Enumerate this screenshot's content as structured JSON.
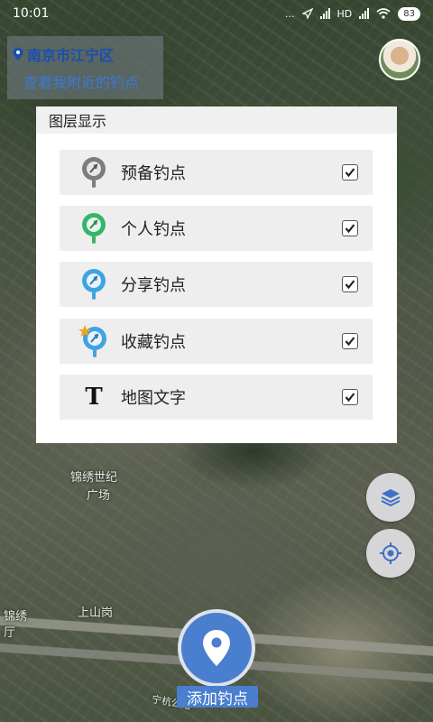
{
  "status_bar": {
    "time": "10:01",
    "dots": "...",
    "network": "HD",
    "battery": "83"
  },
  "location": {
    "city": "南京市江宁区",
    "subtitle": "查看我附近的钓点"
  },
  "map_labels": {
    "plaza": "锦绣世纪",
    "plaza2": "广场",
    "village": "上山岗",
    "left_label": "锦绣",
    "left_label2": "厅",
    "road": "宁杭公路"
  },
  "layer_dialog": {
    "title": "图层显示",
    "items": [
      {
        "label": "预备钓点",
        "icon": "gray-fishing-pin-icon",
        "checked": true
      },
      {
        "label": "个人钓点",
        "icon": "green-fishing-pin-icon",
        "checked": true
      },
      {
        "label": "分享钓点",
        "icon": "blue-fishing-pin-icon",
        "checked": true
      },
      {
        "label": "收藏钓点",
        "icon": "star-fishing-pin-icon",
        "checked": true
      },
      {
        "label": "地图文字",
        "icon": "text-t-icon",
        "checked": true
      }
    ]
  },
  "actions": {
    "add_spot": "添加钓点"
  },
  "colors": {
    "accent": "#4a7ecf",
    "location_title": "#1a4fb0",
    "location_subtitle": "#3d79d3"
  }
}
